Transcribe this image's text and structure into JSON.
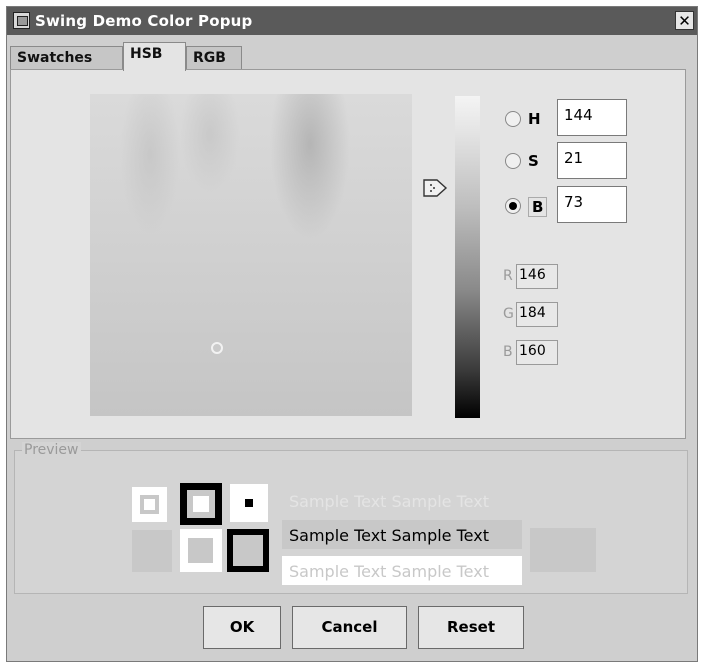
{
  "window": {
    "title": "Swing Demo Color Popup",
    "close_label": "✕"
  },
  "tabs": [
    {
      "label": "Swatches",
      "active": false
    },
    {
      "label": "HSB",
      "active": true
    },
    {
      "label": "RGB",
      "active": false
    }
  ],
  "hsb": {
    "h_label": "H",
    "h_value": "144",
    "s_label": "S",
    "s_value": "21",
    "b_label": "B",
    "b_value": "73",
    "selected_mode": "B"
  },
  "rgb_readout": {
    "r_label": "R",
    "r_value": "146",
    "g_label": "G",
    "g_value": "184",
    "b_label": "B",
    "b_value": "160"
  },
  "preview": {
    "title": "Preview",
    "sample_text": "Sample Text  Sample Text"
  },
  "buttons": {
    "ok": "OK",
    "cancel": "Cancel",
    "reset": "Reset"
  },
  "colors": {
    "selected": "#cacaca",
    "title_bar": "#5a5a5a"
  }
}
